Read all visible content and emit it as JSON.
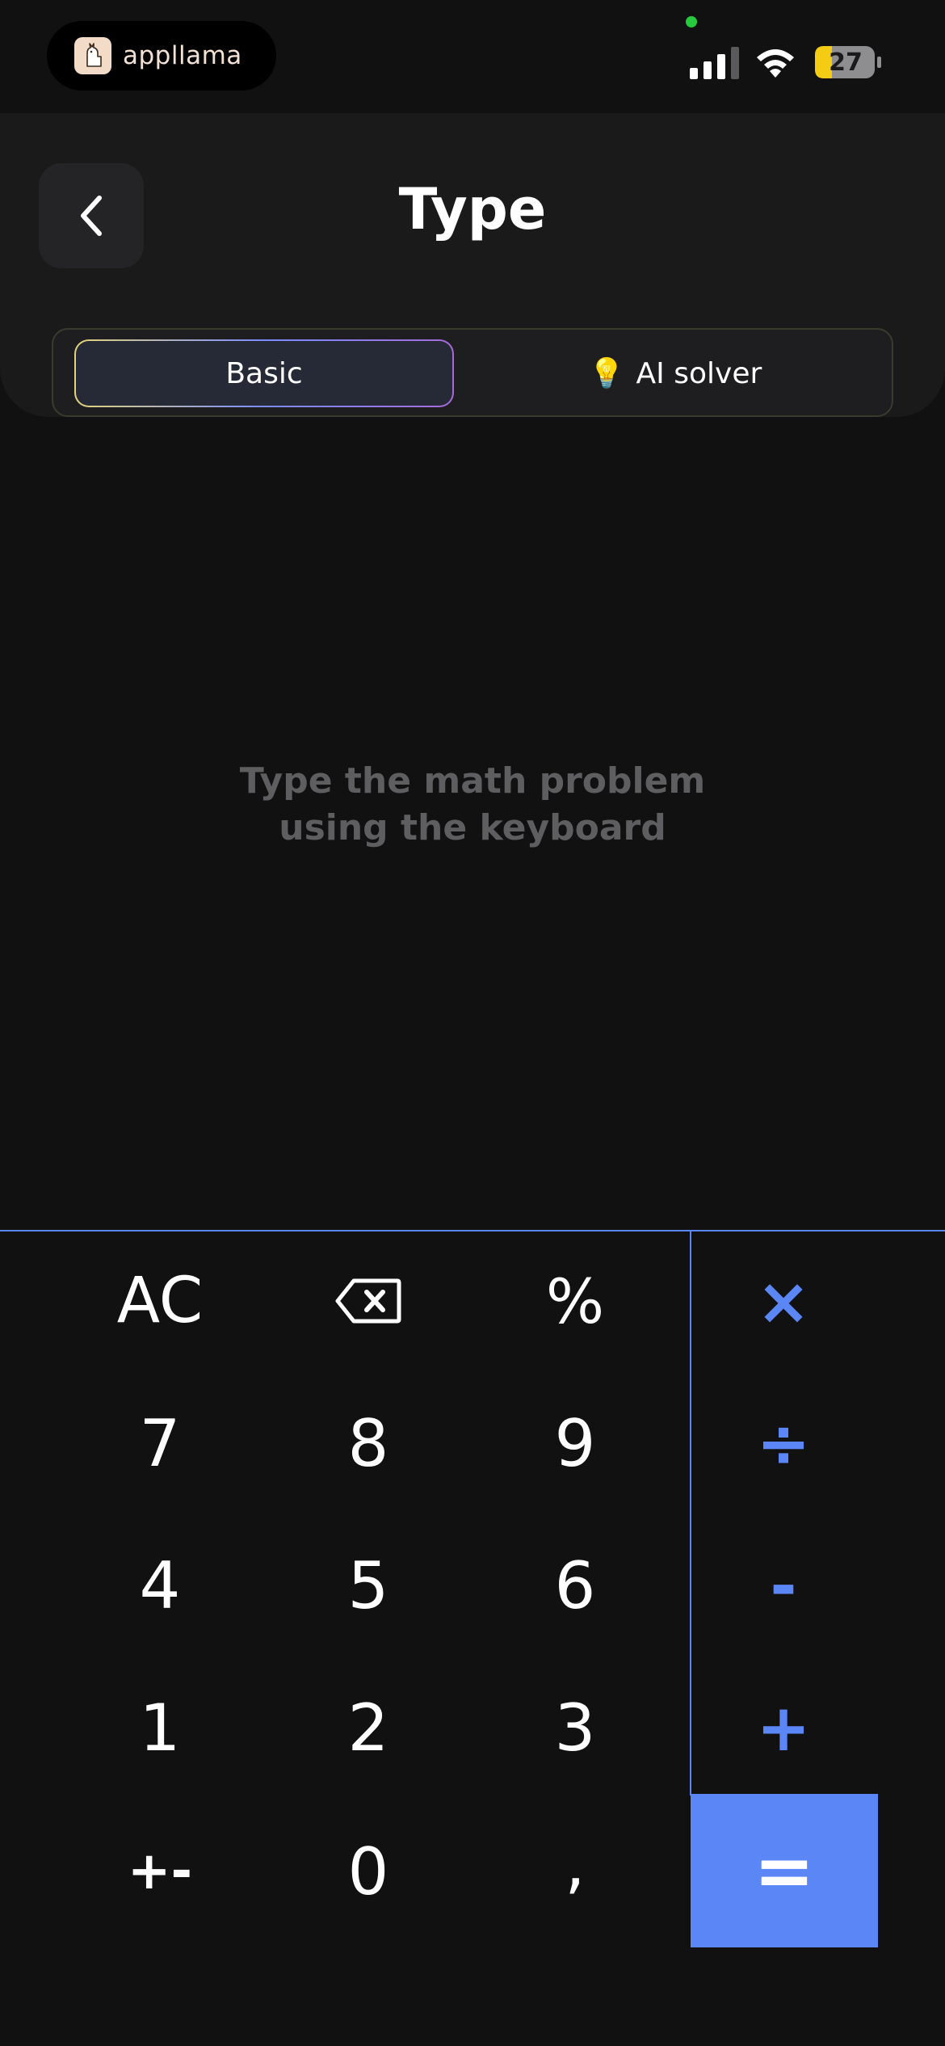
{
  "status_bar": {
    "brand": "appllama",
    "battery": "27"
  },
  "header": {
    "title": "Type"
  },
  "mode_tabs": {
    "basic": "Basic",
    "ai_solver": "AI solver",
    "selected": "Basic"
  },
  "display": {
    "hint_line1": "Type the math problem",
    "hint_line2": "using the keyboard"
  },
  "keypad": {
    "ac": "AC",
    "percent": "%",
    "k7": "7",
    "k8": "8",
    "k9": "9",
    "k4": "4",
    "k5": "5",
    "k6": "6",
    "k1": "1",
    "k2": "2",
    "k3": "3",
    "plus_minus": "+-",
    "k0": "0",
    "comma": ",",
    "multiply": "×",
    "divide": "÷",
    "minus": "-",
    "plus": "+",
    "equals": "="
  },
  "colors": {
    "accent": "#5b86f5",
    "background": "#111112",
    "hint_text": "#5e5e60",
    "battery_fill": "#f5cc14"
  },
  "icons": {
    "back": "chevron-left-icon",
    "backspace": "backspace-icon",
    "bulb": "lightbulb-icon",
    "signal": "cellular-signal-icon",
    "wifi": "wifi-icon",
    "battery": "battery-icon",
    "logo": "llama-icon"
  }
}
